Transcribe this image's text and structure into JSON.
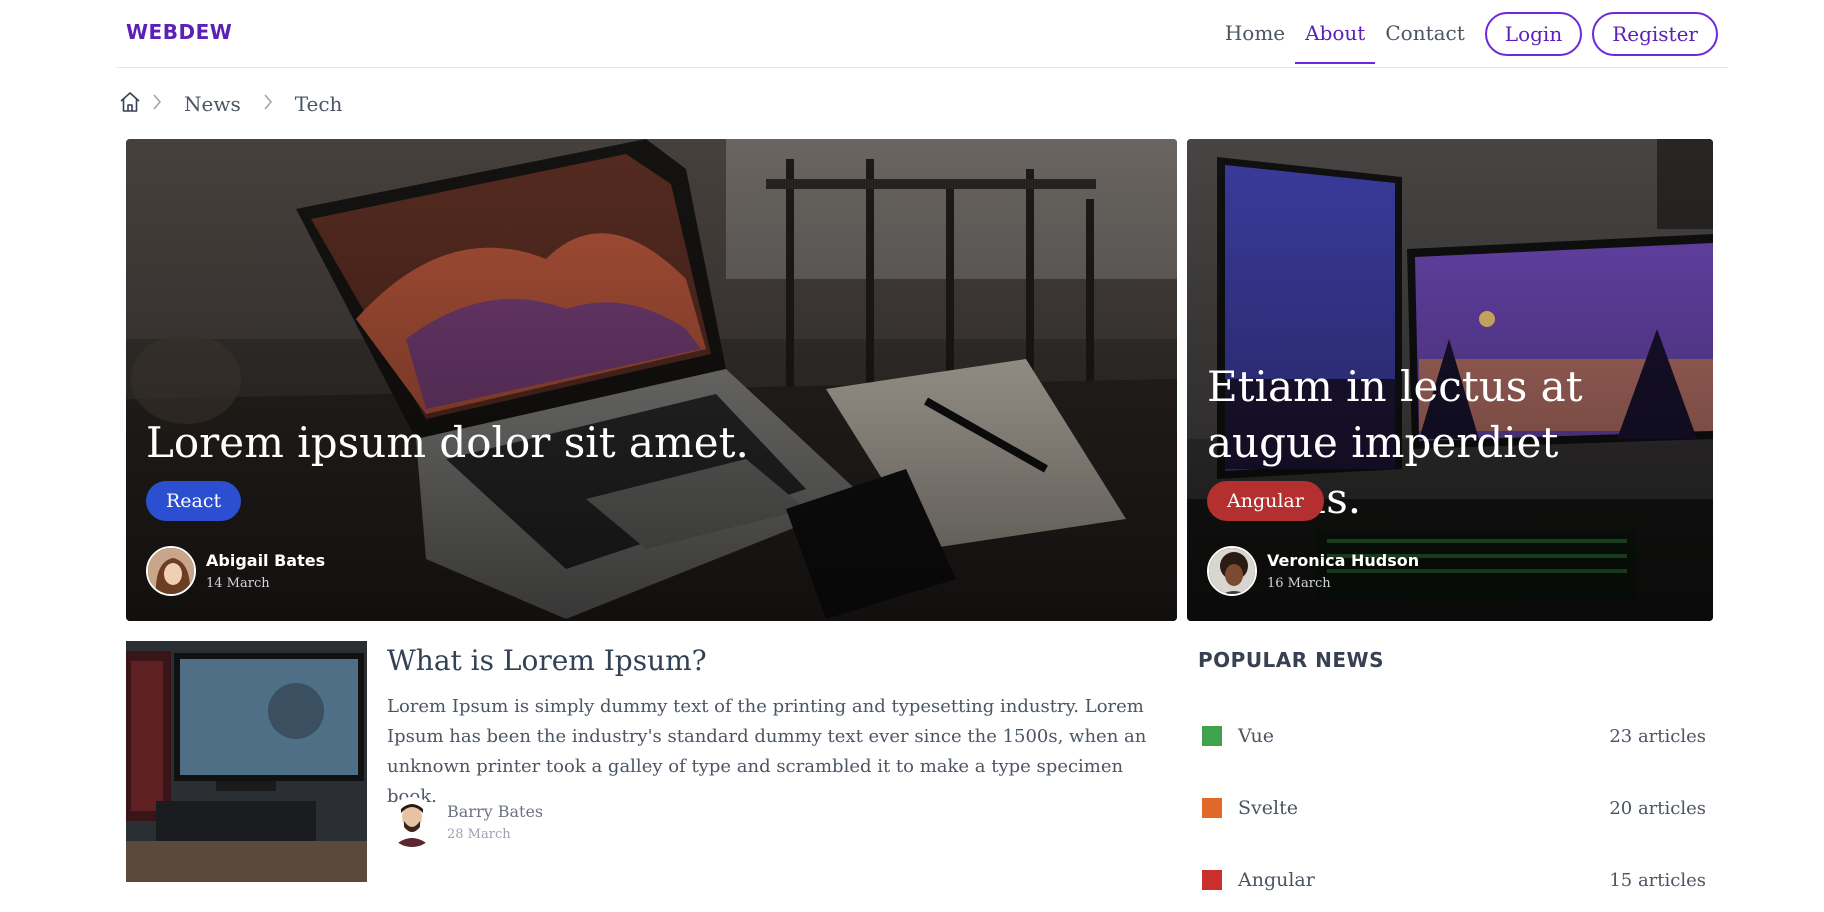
{
  "brand": "WEBDEW",
  "nav": {
    "links": [
      "Home",
      "About",
      "Contact"
    ],
    "login": "Login",
    "register": "Register"
  },
  "breadcrumb": [
    "News",
    "Tech"
  ],
  "featured": [
    {
      "title": "Lorem ipsum dolor sit amet.",
      "tag": "React",
      "tag_color": "#2b4fd0",
      "author": "Abigail Bates",
      "date": "14 March"
    },
    {
      "title": "Etiam in lectus at augue imperdiet cursus.",
      "tag": "Angular",
      "tag_color": "#b42f2f",
      "author": "Veronica Hudson",
      "date": "16 March"
    }
  ],
  "article": {
    "title": "What is Lorem Ipsum?",
    "excerpt": "Lorem Ipsum is simply dummy text of the printing and typesetting industry. Lorem Ipsum has been the industry's standard dummy text ever since the 1500s, when an unknown printer took a galley of type and scrambled it to make a type specimen book.",
    "author": "Barry Bates",
    "date": "28 March"
  },
  "popular": {
    "title": "POPULAR NEWS",
    "items": [
      {
        "label": "Vue",
        "count": "23 articles",
        "color": "#3fa34d"
      },
      {
        "label": "Svelte",
        "count": "20 articles",
        "color": "#e0692a"
      },
      {
        "label": "Angular",
        "count": "15 articles",
        "color": "#c9302c"
      }
    ]
  },
  "colors": {
    "accent": "#6d28d9",
    "brand": "#5b21b6"
  }
}
